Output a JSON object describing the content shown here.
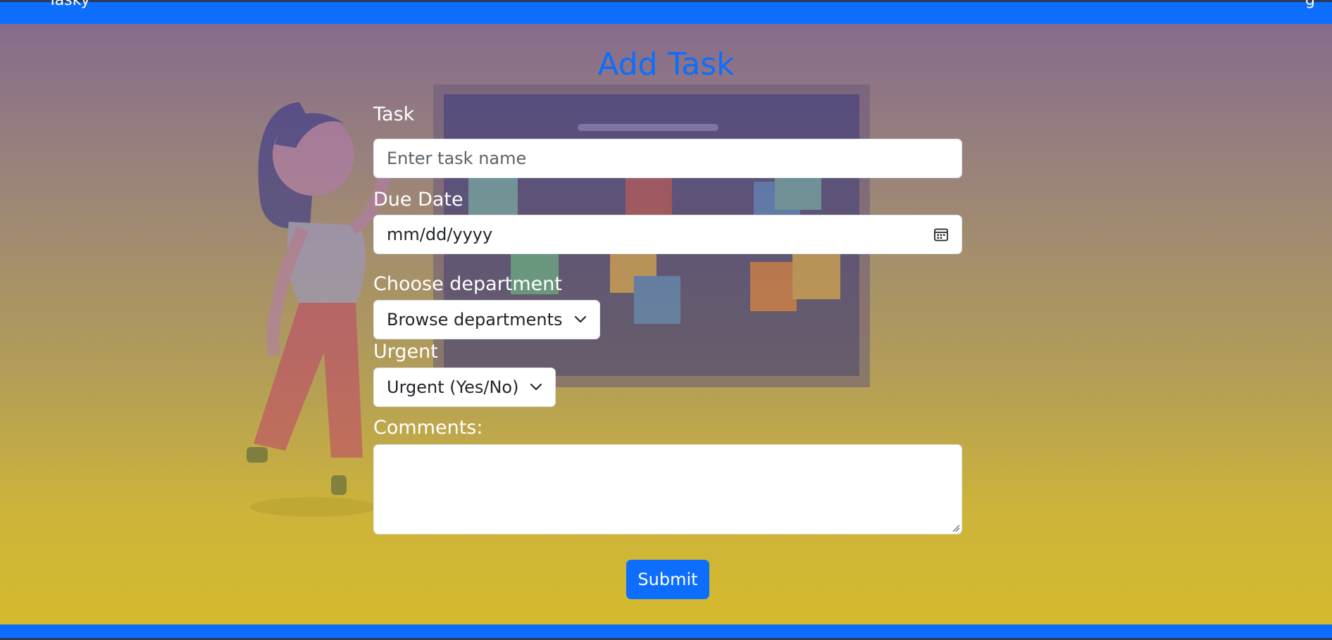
{
  "header": {
    "brand_fragment": "Tasky",
    "right_fragment": "g"
  },
  "page": {
    "title": "Add Task"
  },
  "form": {
    "task": {
      "label": "Task",
      "placeholder": "Enter task name",
      "value": ""
    },
    "due_date": {
      "label": "Due Date",
      "value": "mm/dd/yyyy",
      "icon": "calendar-icon"
    },
    "department": {
      "label": "Choose department",
      "selected": "Browse departments",
      "icon": "chevron-down-icon"
    },
    "urgent": {
      "label": "Urgent",
      "selected": "Urgent (Yes/No)",
      "icon": "chevron-down-icon"
    },
    "comments": {
      "label": "Comments:",
      "value": ""
    },
    "submit_label": "Submit"
  },
  "colors": {
    "accent": "#0d6efd",
    "label_text": "#ffffff",
    "background_top": "#83688f",
    "background_bottom": "#d6ba2c"
  }
}
